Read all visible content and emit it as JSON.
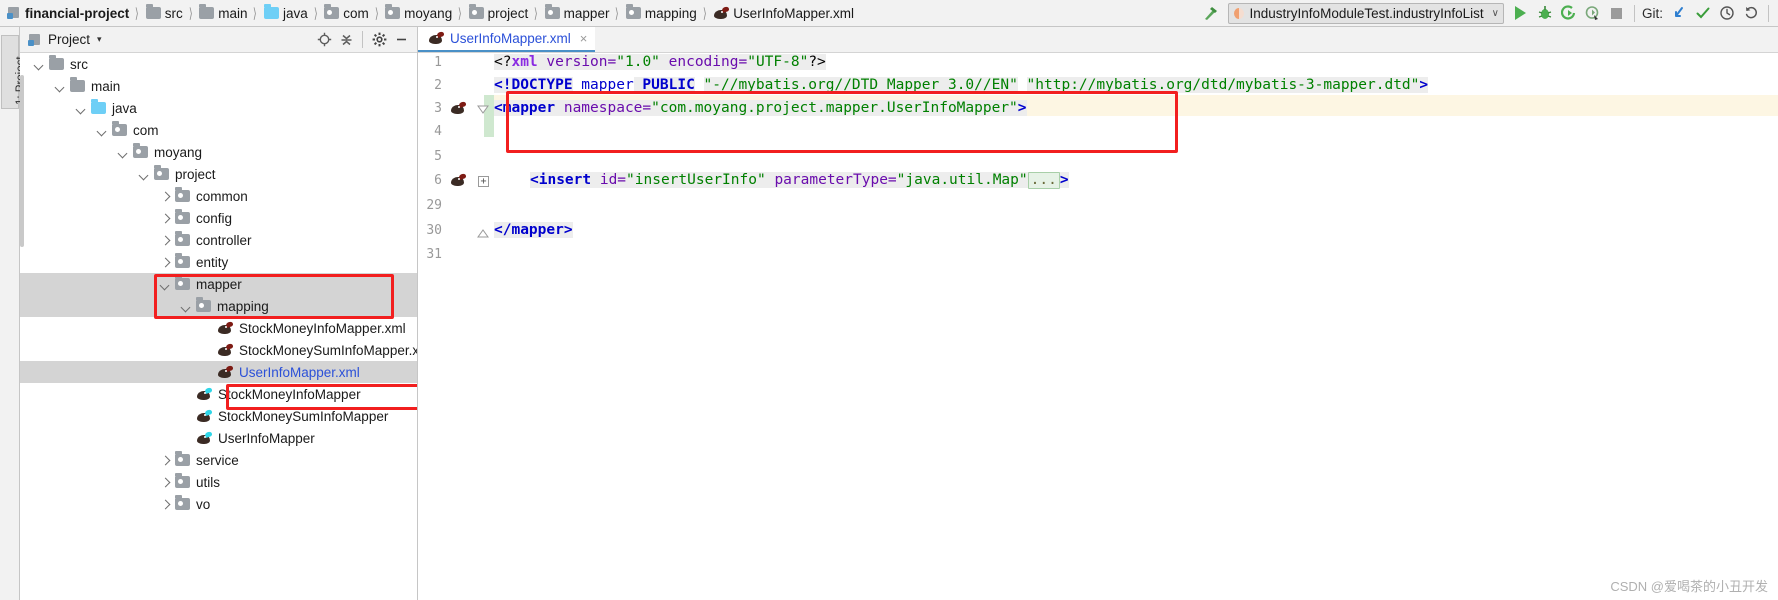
{
  "navbar": {
    "breadcrumbs": [
      {
        "label": "financial-project",
        "icon": "module-icon",
        "kind": "module"
      },
      {
        "label": "src",
        "icon": "folder-icon",
        "kind": "folder"
      },
      {
        "label": "main",
        "icon": "folder-icon",
        "kind": "folder"
      },
      {
        "label": "java",
        "icon": "source-folder-icon",
        "kind": "folder-blue"
      },
      {
        "label": "com",
        "icon": "package-icon",
        "kind": "package"
      },
      {
        "label": "moyang",
        "icon": "package-icon",
        "kind": "package"
      },
      {
        "label": "project",
        "icon": "package-icon",
        "kind": "package"
      },
      {
        "label": "mapper",
        "icon": "package-icon",
        "kind": "package"
      },
      {
        "label": "mapping",
        "icon": "package-icon",
        "kind": "package"
      },
      {
        "label": "UserInfoMapper.xml",
        "icon": "mybatis-mapper-icon",
        "kind": "file"
      }
    ],
    "run_config": {
      "label": "IndustryInfoModuleTest.industryInfoList",
      "caret": "∨"
    },
    "git_label": "Git:",
    "buttons": [
      {
        "name": "build-button",
        "icon": "hammer-icon"
      },
      {
        "name": "run-button",
        "icon": "run-triangle-icon"
      },
      {
        "name": "debug-button",
        "icon": "debug-bug-icon"
      },
      {
        "name": "run-coverage-button",
        "icon": "run-coverage-icon"
      },
      {
        "name": "profile-button",
        "icon": "profiler-icon"
      },
      {
        "name": "stop-button",
        "icon": "stop-square-icon"
      },
      {
        "name": "git-update-button",
        "icon": "update-project-icon"
      },
      {
        "name": "git-commit-button",
        "icon": "commit-check-icon"
      },
      {
        "name": "git-history-button",
        "icon": "history-clock-icon"
      },
      {
        "name": "git-rollback-button",
        "icon": "rollback-arrow-icon"
      }
    ]
  },
  "toolstrip": {
    "project_tab": "1: Project"
  },
  "project_panel": {
    "title": "Project",
    "caret": "▾",
    "actions": [
      {
        "name": "locate-in-tree-button",
        "icon": "crosshair-icon"
      },
      {
        "name": "collapse-all-button",
        "icon": "collapse-all-icon"
      },
      {
        "name": "settings-button",
        "icon": "gear-icon"
      },
      {
        "name": "hide-button",
        "icon": "minimize-icon"
      }
    ],
    "tree": [
      {
        "label": "src",
        "depth": 1,
        "arrow": "down",
        "icon": "folder-icon",
        "selected": false,
        "link": false
      },
      {
        "label": "main",
        "depth": 2,
        "arrow": "down",
        "icon": "folder-icon",
        "selected": false,
        "link": false
      },
      {
        "label": "java",
        "depth": 3,
        "arrow": "down",
        "icon": "source-folder-icon",
        "selected": false,
        "link": false
      },
      {
        "label": "com",
        "depth": 4,
        "arrow": "down",
        "icon": "package-icon",
        "selected": false,
        "link": false
      },
      {
        "label": "moyang",
        "depth": 5,
        "arrow": "down",
        "icon": "package-icon",
        "selected": false,
        "link": false
      },
      {
        "label": "project",
        "depth": 6,
        "arrow": "down",
        "icon": "package-icon",
        "selected": false,
        "link": false
      },
      {
        "label": "common",
        "depth": 7,
        "arrow": "right",
        "icon": "package-icon",
        "selected": false,
        "link": false
      },
      {
        "label": "config",
        "depth": 7,
        "arrow": "right",
        "icon": "package-icon",
        "selected": false,
        "link": false
      },
      {
        "label": "controller",
        "depth": 7,
        "arrow": "right",
        "icon": "package-icon",
        "selected": false,
        "link": false
      },
      {
        "label": "entity",
        "depth": 7,
        "arrow": "right",
        "icon": "package-icon",
        "selected": false,
        "link": false
      },
      {
        "label": "mapper",
        "depth": 7,
        "arrow": "down",
        "icon": "package-icon",
        "selected": true,
        "link": false
      },
      {
        "label": "mapping",
        "depth": 8,
        "arrow": "down",
        "icon": "package-icon",
        "selected": true,
        "link": false
      },
      {
        "label": "StockMoneyInfoMapper.xml",
        "depth": 9,
        "arrow": "none",
        "icon": "mybatis-mapper-icon",
        "selected": false,
        "link": false
      },
      {
        "label": "StockMoneySumInfoMapper.xml",
        "depth": 9,
        "arrow": "none",
        "icon": "mybatis-mapper-icon",
        "selected": false,
        "link": false
      },
      {
        "label": "UserInfoMapper.xml",
        "depth": 9,
        "arrow": "none",
        "icon": "mybatis-mapper-icon",
        "selected": true,
        "link": true
      },
      {
        "label": "StockMoneyInfoMapper",
        "depth": 8,
        "arrow": "none",
        "icon": "mybatis-java-icon",
        "selected": false,
        "link": false
      },
      {
        "label": "StockMoneySumInfoMapper",
        "depth": 8,
        "arrow": "none",
        "icon": "mybatis-java-icon",
        "selected": false,
        "link": false
      },
      {
        "label": "UserInfoMapper",
        "depth": 8,
        "arrow": "none",
        "icon": "mybatis-java-icon",
        "selected": false,
        "link": false
      },
      {
        "label": "service",
        "depth": 7,
        "arrow": "right",
        "icon": "package-icon",
        "selected": false,
        "link": false
      },
      {
        "label": "utils",
        "depth": 7,
        "arrow": "right",
        "icon": "package-icon",
        "selected": false,
        "link": false
      },
      {
        "label": "vo",
        "depth": 7,
        "arrow": "right",
        "icon": "package-icon",
        "selected": false,
        "link": false
      }
    ]
  },
  "editor": {
    "tab": {
      "label": "UserInfoMapper.xml",
      "close": "×",
      "icon": "mybatis-mapper-icon"
    },
    "gutter_numbers": [
      "1",
      "2",
      "3",
      "4",
      "5",
      "6",
      "29",
      "30",
      "31"
    ],
    "code": {
      "line1": {
        "p1": "<?",
        "p2": "xml",
        "p3": " version=",
        "p4": "\"1.0\"",
        "p5": " encoding=",
        "p6": "\"UTF-8\"",
        "p7": "?>"
      },
      "line2": {
        "p1": "<!DOCTYPE",
        "p2": " mapper",
        "p3": " PUBLIC",
        "p4": " ",
        "p5": "\"-//mybatis.org//DTD Mapper 3.0//EN\"",
        "p6": " ",
        "p7": "\"http://mybatis.org/dtd/mybatis-3-mapper.dtd\"",
        "p8": ">"
      },
      "line3": {
        "p1": "<mapper",
        "p2": " namespace=",
        "p3": "\"com.moyang.project.mapper.UserInfoMapper\"",
        "p4": ">"
      },
      "line6": {
        "p1": "<insert",
        "p2": " id=",
        "p3": "\"insertUserInfo\"",
        "p4": " parameterType=",
        "p5": "\"java.util.Map\"",
        "p6": "...",
        "p7": ">"
      },
      "line30": {
        "p1": "</mapper>"
      }
    }
  },
  "watermark": "CSDN @爱喝茶的小丑开发",
  "colors": {
    "accent_blue": "#2b50d8",
    "annotation_red": "#f21f1f",
    "selection_gray": "#d4d4d4",
    "caret_line": "#fdf6e3",
    "string_green": "#008000",
    "tag_blue": "#0000cd",
    "attr_purple": "#6a0dad"
  }
}
